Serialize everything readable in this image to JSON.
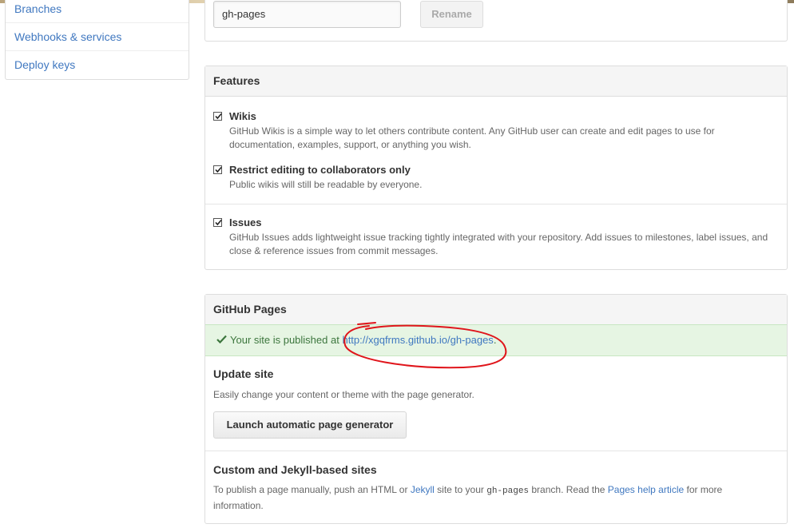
{
  "sidebar": {
    "items": [
      {
        "label": "Branches"
      },
      {
        "label": "Webhooks & services"
      },
      {
        "label": "Deploy keys"
      }
    ]
  },
  "branch": {
    "input_value": "gh-pages",
    "rename_label": "Rename"
  },
  "features": {
    "title": "Features",
    "items": [
      {
        "label": "Wikis",
        "description": "GitHub Wikis is a simple way to let others contribute content. Any GitHub user can create and edit pages to use for documentation, examples, support, or anything you wish.",
        "checked": true
      },
      {
        "label": "Restrict editing to collaborators only",
        "description": "Public wikis will still be readable by everyone.",
        "checked": true
      },
      {
        "label": "Issues",
        "description": "GitHub Issues adds lightweight issue tracking tightly integrated with your repository. Add issues to milestones, label issues, and close & reference issues from commit messages.",
        "checked": true
      }
    ]
  },
  "pages": {
    "title": "GitHub Pages",
    "published_prefix": "Your site is published at",
    "published_url": "http://xgqfrms.github.io/gh-pages",
    "published_suffix": ".",
    "update_title": "Update site",
    "update_desc": "Easily change your content or theme with the page generator.",
    "generator_button": "Launch automatic page generator",
    "custom_title": "Custom and Jekyll-based sites",
    "custom_desc_1": "To publish a page manually, push an HTML or",
    "custom_link_jekyll": "Jekyll",
    "custom_desc_2": "site to your",
    "custom_code": "gh-pages",
    "custom_desc_3": "branch. Read the",
    "custom_link_help": "Pages help article",
    "custom_desc_4": "for more information."
  },
  "colors": {
    "link": "#4078c0",
    "success_bg": "#e6f5e3",
    "annotation": "#e0151b"
  },
  "icons": {
    "checkbox": "checkbox-checked-icon",
    "success": "check-icon"
  }
}
